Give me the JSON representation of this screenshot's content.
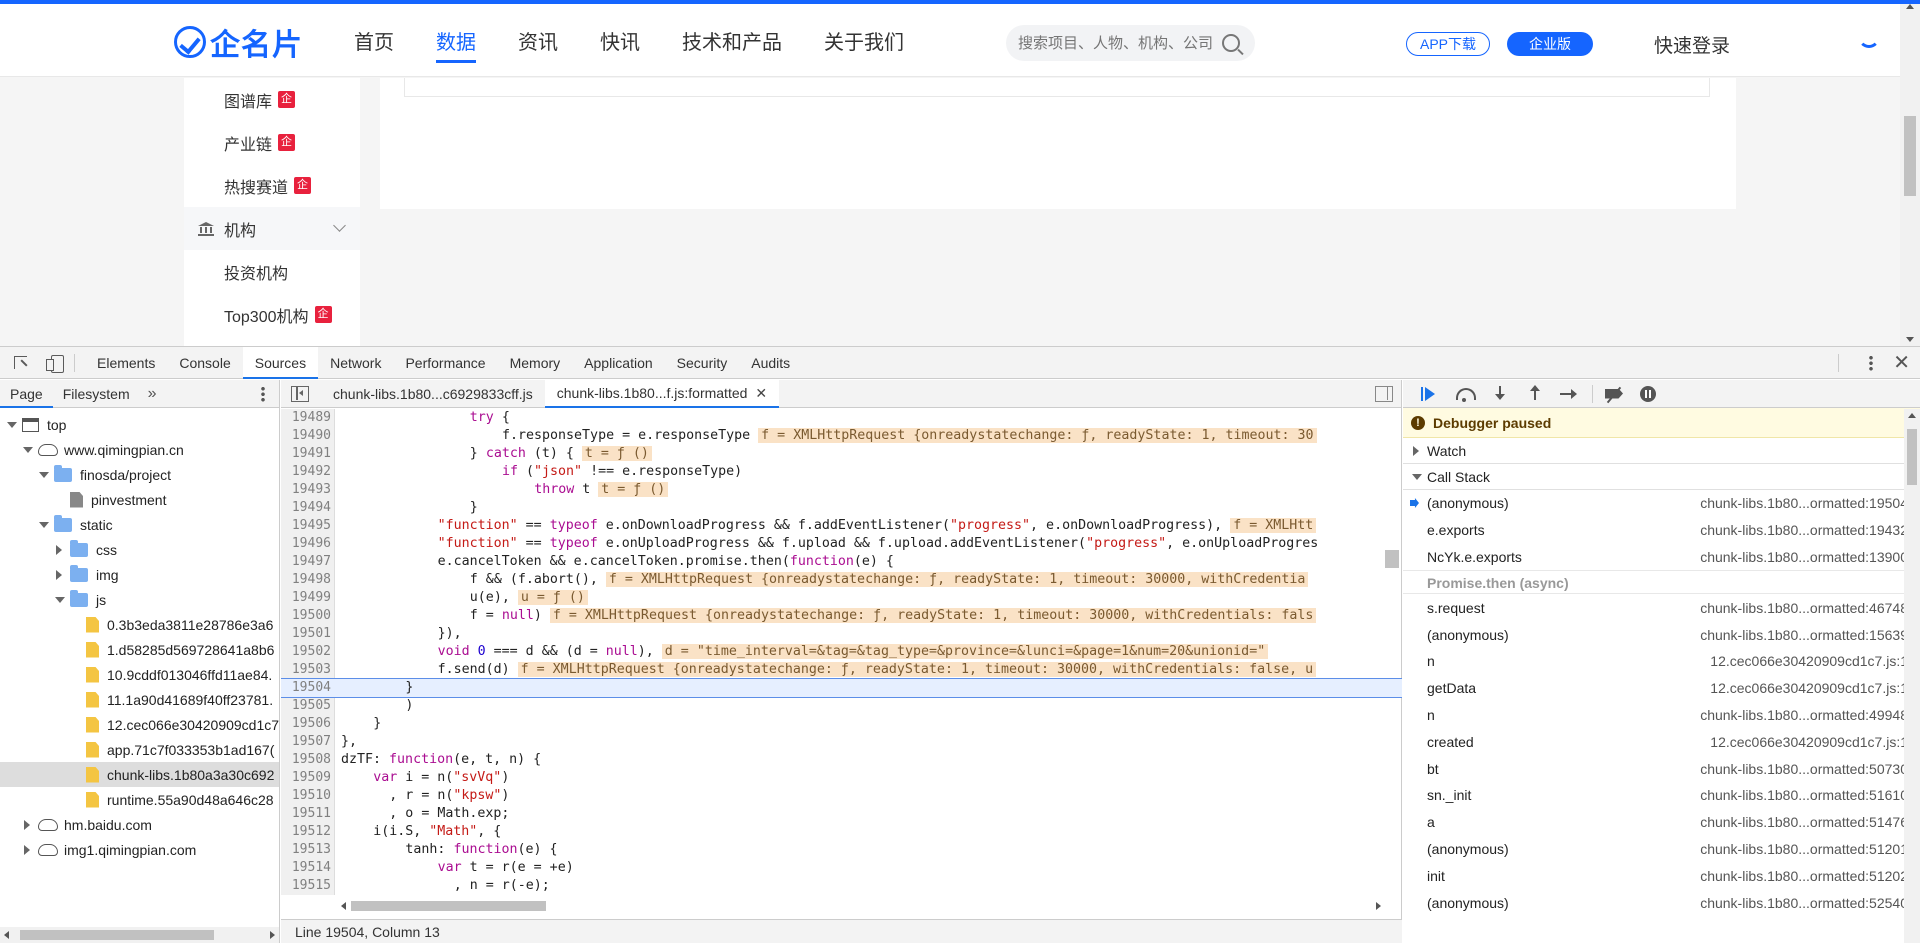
{
  "site": {
    "logo_text": "企名片",
    "nav": [
      "首页",
      "数据",
      "资讯",
      "快讯",
      "技术和产品",
      "关于我们"
    ],
    "nav_active_index": 1,
    "search_placeholder": "搜索项目、人物、机构、公司",
    "app_download": "APP下载",
    "enterprise": "企业版",
    "login": "快速登录",
    "side_items": [
      {
        "label": "图谱库",
        "badge": "企"
      },
      {
        "label": "产业链",
        "badge": "企"
      },
      {
        "label": "热搜赛道",
        "badge": "企"
      }
    ],
    "side_group": "机构",
    "side_sub_items": [
      {
        "label": "投资机构",
        "badge": ""
      },
      {
        "label": "Top300机构",
        "badge": "企"
      }
    ]
  },
  "devtools": {
    "tabs": [
      "Elements",
      "Console",
      "Sources",
      "Network",
      "Performance",
      "Memory",
      "Application",
      "Security",
      "Audits"
    ],
    "active_tab": "Sources",
    "navigator_tabs": [
      "Page",
      "Filesystem"
    ],
    "more_tabs": "»",
    "tree": [
      {
        "label": "top",
        "level": 0,
        "icon": "frame",
        "expand": "down"
      },
      {
        "label": "www.qimingpian.cn",
        "level": 1,
        "icon": "cloud",
        "expand": "down"
      },
      {
        "label": "finosda/project",
        "level": 2,
        "icon": "folder",
        "expand": "down"
      },
      {
        "label": "pinvestment",
        "level": 3,
        "icon": "file",
        "expand": "none"
      },
      {
        "label": "static",
        "level": 2,
        "icon": "folder",
        "expand": "down"
      },
      {
        "label": "css",
        "level": 3,
        "icon": "folder",
        "expand": "right"
      },
      {
        "label": "img",
        "level": 3,
        "icon": "folder",
        "expand": "right"
      },
      {
        "label": "js",
        "level": 3,
        "icon": "folder",
        "expand": "down"
      },
      {
        "label": "0.3b3eda3811e28786e3a6",
        "level": 4,
        "icon": "js",
        "expand": "none"
      },
      {
        "label": "1.d58285d569728641a8b6",
        "level": 4,
        "icon": "js",
        "expand": "none"
      },
      {
        "label": "10.9cddf013046ffd11ae84.",
        "level": 4,
        "icon": "js",
        "expand": "none"
      },
      {
        "label": "11.1a90d41689f40ff23781.",
        "level": 4,
        "icon": "js",
        "expand": "none"
      },
      {
        "label": "12.cec066e30420909cd1c7",
        "level": 4,
        "icon": "js",
        "expand": "none"
      },
      {
        "label": "app.71c7f033353b1ad167(",
        "level": 4,
        "icon": "js",
        "expand": "none"
      },
      {
        "label": "chunk-libs.1b80a3a30c692",
        "level": 4,
        "icon": "js",
        "expand": "none",
        "selected": true
      },
      {
        "label": "runtime.55a90d48a646c28",
        "level": 4,
        "icon": "js",
        "expand": "none"
      },
      {
        "label": "hm.baidu.com",
        "level": 1,
        "icon": "cloud",
        "expand": "right"
      },
      {
        "label": "img1.qimingpian.com",
        "level": 1,
        "icon": "cloud",
        "expand": "right"
      }
    ],
    "editor_tabs": [
      {
        "label": "chunk-libs.1b80...c6929833cff.js",
        "closable": false
      },
      {
        "label": "chunk-libs.1b80...f.js:formatted",
        "closable": true,
        "active": true
      }
    ],
    "code_lines": [
      {
        "n": "19489",
        "indent": 16,
        "code": "try {",
        "inline": ""
      },
      {
        "n": "19490",
        "indent": 20,
        "code": "f.responseType = e.responseType",
        "inline": "f = XMLHttpRequest {onreadystatechange: ƒ, readyState: 1, timeout: 30"
      },
      {
        "n": "19491",
        "indent": 16,
        "code": "} catch (t) {",
        "inline": "t = ƒ ()"
      },
      {
        "n": "19492",
        "indent": 20,
        "code": "if (\"json\" !== e.responseType)",
        "inline": ""
      },
      {
        "n": "19493",
        "indent": 24,
        "code": "throw t",
        "inline": "t = ƒ ()"
      },
      {
        "n": "19494",
        "indent": 16,
        "code": "}",
        "inline": ""
      },
      {
        "n": "19495",
        "indent": 12,
        "code": "\"function\" == typeof e.onDownloadProgress && f.addEventListener(\"progress\", e.onDownloadProgress),",
        "inline": "f = XMLHtt"
      },
      {
        "n": "19496",
        "indent": 12,
        "code": "\"function\" == typeof e.onUploadProgress && f.upload && f.upload.addEventListener(\"progress\", e.onUploadProgres",
        "inline": ""
      },
      {
        "n": "19497",
        "indent": 12,
        "code": "e.cancelToken && e.cancelToken.promise.then(function(e) {",
        "inline": ""
      },
      {
        "n": "19498",
        "indent": 16,
        "code": "f && (f.abort(),",
        "inline": "f = XMLHttpRequest {onreadystatechange: ƒ, readyState: 1, timeout: 30000, withCredentia"
      },
      {
        "n": "19499",
        "indent": 16,
        "code": "u(e),",
        "inline": "u = ƒ ()"
      },
      {
        "n": "19500",
        "indent": 16,
        "code": "f = null)",
        "inline": "f = XMLHttpRequest {onreadystatechange: ƒ, readyState: 1, timeout: 30000, withCredentials: fals"
      },
      {
        "n": "19501",
        "indent": 12,
        "code": "}),",
        "inline": ""
      },
      {
        "n": "19502",
        "indent": 12,
        "code": "void 0 === d && (d = null),",
        "inline": "d = \"time_interval=&tag=&tag_type=&province=&lunci=&page=1&num=20&unionid=\""
      },
      {
        "n": "19503",
        "indent": 12,
        "code": "f.send(d)",
        "inline": "f = XMLHttpRequest {onreadystatechange: ƒ, readyState: 1, timeout: 30000, withCredentials: false, u"
      },
      {
        "n": "19504",
        "indent": 8,
        "code": "}",
        "inline": "",
        "exec": true
      },
      {
        "n": "19505",
        "indent": 8,
        "code": ")",
        "inline": ""
      },
      {
        "n": "19506",
        "indent": 4,
        "code": "}",
        "inline": ""
      },
      {
        "n": "19507",
        "indent": 0,
        "code": "},",
        "inline": ""
      },
      {
        "n": "19508",
        "indent": 0,
        "code": "dzTF: function(e, t, n) {",
        "inline": ""
      },
      {
        "n": "19509",
        "indent": 4,
        "code": "var i = n(\"svVq\")",
        "inline": ""
      },
      {
        "n": "19510",
        "indent": 6,
        "code": ", r = n(\"kpsw\")",
        "inline": ""
      },
      {
        "n": "19511",
        "indent": 6,
        "code": ", o = Math.exp;",
        "inline": ""
      },
      {
        "n": "19512",
        "indent": 4,
        "code": "i(i.S, \"Math\", {",
        "inline": ""
      },
      {
        "n": "19513",
        "indent": 8,
        "code": "tanh: function(e) {",
        "inline": ""
      },
      {
        "n": "19514",
        "indent": 12,
        "code": "var t = r(e = +e)",
        "inline": ""
      },
      {
        "n": "19515",
        "indent": 14,
        "code": ", n = r(-e);",
        "inline": ""
      },
      {
        "n": "19516",
        "indent": 0,
        "code": "",
        "inline": ""
      }
    ],
    "status": "Line 19504, Column 13",
    "debugger_paused": "Debugger paused",
    "watch_label": "Watch",
    "call_stack_label": "Call Stack",
    "call_stack": [
      {
        "fn": "(anonymous)",
        "loc": "chunk-libs.1b80...ormatted:19504",
        "current": true
      },
      {
        "fn": "e.exports",
        "loc": "chunk-libs.1b80...ormatted:19432"
      },
      {
        "fn": "NcYk.e.exports",
        "loc": "chunk-libs.1b80...ormatted:13900"
      },
      {
        "async": "Promise.then (async)"
      },
      {
        "fn": "s.request",
        "loc": "chunk-libs.1b80...ormatted:46748"
      },
      {
        "fn": "(anonymous)",
        "loc": "chunk-libs.1b80...ormatted:15639"
      },
      {
        "fn": "n",
        "loc": "12.cec066e30420909cd1c7.js:1"
      },
      {
        "fn": "getData",
        "loc": "12.cec066e30420909cd1c7.js:1"
      },
      {
        "fn": "n",
        "loc": "chunk-libs.1b80...ormatted:49948"
      },
      {
        "fn": "created",
        "loc": "12.cec066e30420909cd1c7.js:1"
      },
      {
        "fn": "bt",
        "loc": "chunk-libs.1b80...ormatted:50730"
      },
      {
        "fn": "sn._init",
        "loc": "chunk-libs.1b80...ormatted:51610"
      },
      {
        "fn": "a",
        "loc": "chunk-libs.1b80...ormatted:51476"
      },
      {
        "fn": "(anonymous)",
        "loc": "chunk-libs.1b80...ormatted:51201"
      },
      {
        "fn": "init",
        "loc": "chunk-libs.1b80...ormatted:51202"
      },
      {
        "fn": "(anonymous)",
        "loc": "chunk-libs.1b80...ormatted:52540"
      }
    ]
  }
}
